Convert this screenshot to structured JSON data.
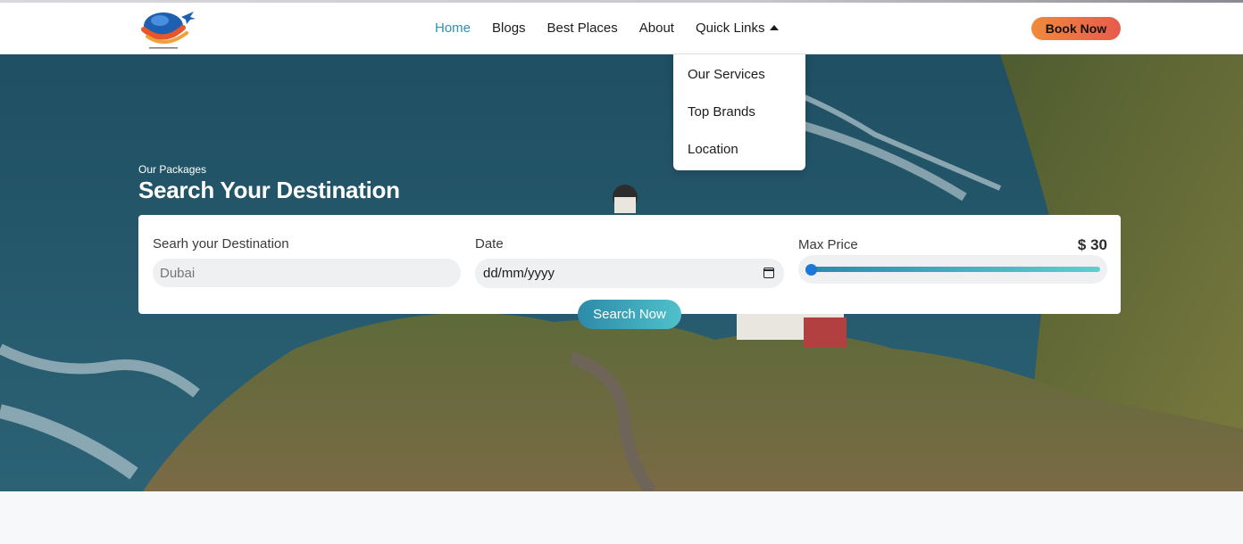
{
  "nav": {
    "items": [
      {
        "label": "Home",
        "active": true
      },
      {
        "label": "Blogs"
      },
      {
        "label": "Best Places"
      },
      {
        "label": "About"
      },
      {
        "label": "Quick Links"
      }
    ],
    "book_label": "Book Now"
  },
  "dropdown": {
    "items": [
      "Our Services",
      "Top Brands",
      "Location"
    ]
  },
  "hero": {
    "eyebrow": "Our Packages",
    "title": "Search Your Destination"
  },
  "search": {
    "destination_label": "Searh your Destination",
    "destination_placeholder": "Dubai",
    "date_label": "Date",
    "date_placeholder": "dd/mm/yyyy",
    "price_label": "Max Price",
    "price_value": "$ 30",
    "price_fraction": 0.0,
    "button_label": "Search Now"
  },
  "colors": {
    "accent": "#2f8fb8",
    "book_gradient_start": "#f08a3c",
    "book_gradient_end": "#e85a4d",
    "range_thumb": "#1a78d6"
  },
  "icons": [
    "globe-plane-logo",
    "caret-up-icon",
    "calendar-icon"
  ]
}
